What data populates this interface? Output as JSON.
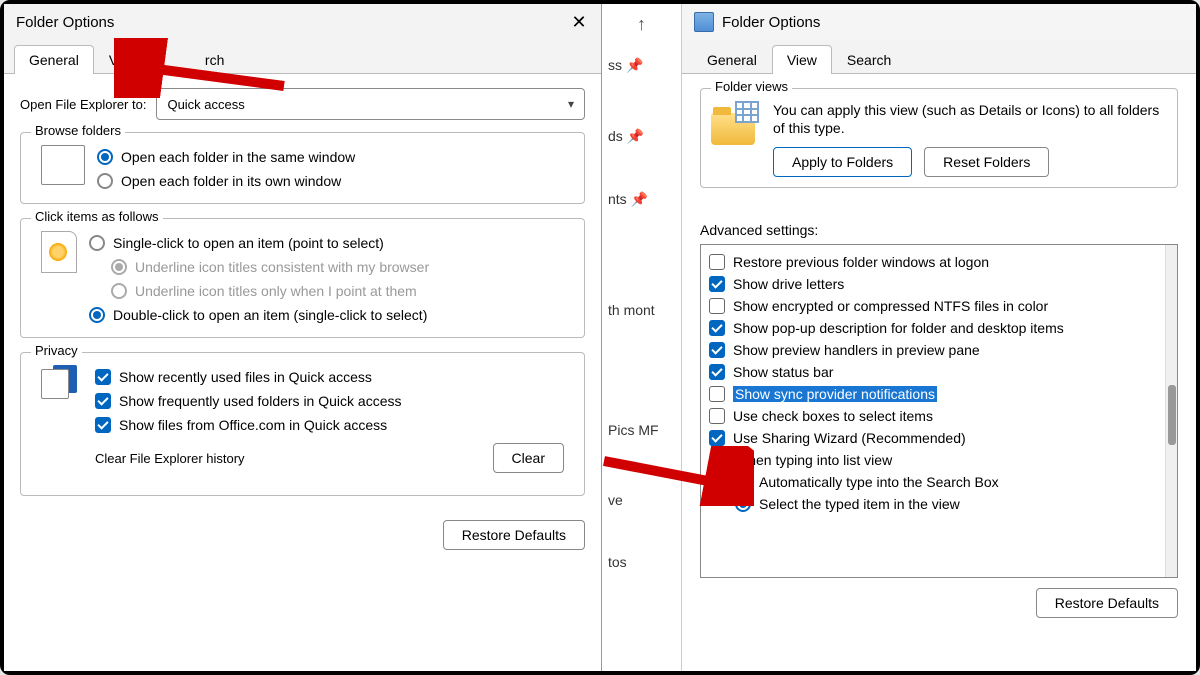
{
  "left": {
    "title": "Folder Options",
    "tabs": {
      "general": "General",
      "view": "View",
      "search": "Search",
      "searchPartial": "rch"
    },
    "openExplorerLabel": "Open File Explorer to:",
    "openExplorerValue": "Quick access",
    "browseFolders": {
      "legend": "Browse folders",
      "same": "Open each folder in the same window",
      "own": "Open each folder in its own window"
    },
    "clickItems": {
      "legend": "Click items as follows",
      "single": "Single-click to open an item (point to select)",
      "under1": "Underline icon titles consistent with my browser",
      "under2": "Underline icon titles only when I point at them",
      "double": "Double-click to open an item (single-click to select)"
    },
    "privacy": {
      "legend": "Privacy",
      "recent": "Show recently used files in Quick access",
      "frequent": "Show frequently used folders in Quick access",
      "office": "Show files from Office.com in Quick access",
      "clearLabel": "Clear File Explorer history",
      "clearBtn": "Clear"
    },
    "restore": "Restore Defaults"
  },
  "mid": {
    "items": [
      "ss",
      "ds",
      "nts",
      "th mont",
      "Pics MF",
      "ve",
      "tos"
    ]
  },
  "right": {
    "title": "Folder Options",
    "tabs": {
      "general": "General",
      "view": "View",
      "search": "Search"
    },
    "folderViews": {
      "legend": "Folder views",
      "desc": "You can apply this view (such as Details or Icons) to all folders of this type.",
      "apply": "Apply to Folders",
      "reset": "Reset Folders"
    },
    "advLabel": "Advanced settings:",
    "adv": [
      {
        "label": "Restore previous folder windows at logon",
        "checked": false
      },
      {
        "label": "Show drive letters",
        "checked": true
      },
      {
        "label": "Show encrypted or compressed NTFS files in color",
        "checked": false
      },
      {
        "label": "Show pop-up description for folder and desktop items",
        "checked": true
      },
      {
        "label": "Show preview handlers in preview pane",
        "checked": true
      },
      {
        "label": "Show status bar",
        "checked": true
      },
      {
        "label": "Show sync provider notifications",
        "checked": false,
        "highlight": true
      },
      {
        "label": "Use check boxes to select items",
        "checked": false
      },
      {
        "label": "Use Sharing Wizard (Recommended)",
        "checked": true
      }
    ],
    "typing": {
      "label": "When typing into list view",
      "auto": "Automatically type into the Search Box",
      "select": "Select the typed item in the view"
    },
    "restore": "Restore Defaults"
  }
}
